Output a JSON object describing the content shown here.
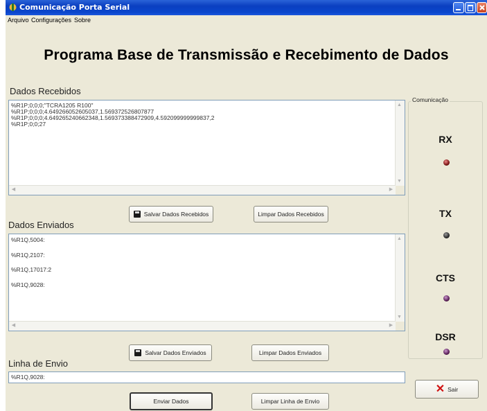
{
  "window": {
    "title": "Comunicação Porta Serial"
  },
  "menu": [
    "Arquivo",
    "Configurações",
    "Sobre"
  ],
  "heading": "Programa Base de Transmissão e Recebimento de Dados",
  "received": {
    "label": "Dados Recebidos",
    "lines": [
      "%R1P;0;0;0;\"TCRA1205 R100\"",
      "%R1P;0;0;0;4.649266052605037,1.569372526807877",
      "%R1P;0;0;0;4.649265240662348,1.569373388472909,4.592099999999837,2",
      "%R1P;0;0;27"
    ],
    "save_button": "Salvar Dados Recebidos",
    "clear_button": "Limpar Dados Recebidos"
  },
  "sent": {
    "label": "Dados Enviados",
    "lines": [
      "%R1Q,5004:",
      "%R1Q,2107:",
      "%R1Q,17017:2",
      "%R1Q,9028:"
    ],
    "save_button": "Salvar Dados Enviados",
    "clear_button": "Limpar Dados Enviados"
  },
  "send_line": {
    "label": "Linha de Envio",
    "value": "%R1Q,9028:",
    "send_button": "Enviar Dados",
    "clear_button": "Limpar Linha de Envio"
  },
  "communication": {
    "label": "Comunicação",
    "indicators": [
      {
        "name": "RX",
        "state": "red"
      },
      {
        "name": "TX",
        "state": "off"
      },
      {
        "name": "CTS",
        "state": "purple"
      },
      {
        "name": "DSR",
        "state": "purple"
      }
    ]
  },
  "exit_button": "Sair",
  "colors": {
    "titlebar": "#0a46cc",
    "background": "#ece9d8",
    "exit_icon": "#d01010"
  }
}
